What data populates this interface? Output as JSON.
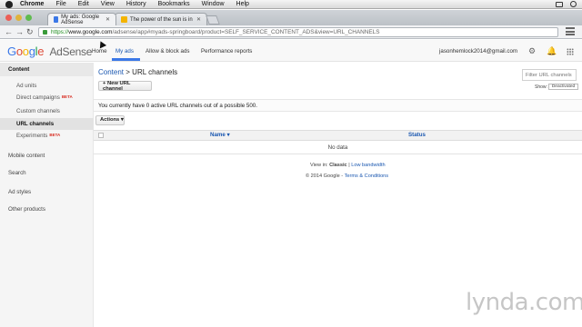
{
  "menubar": {
    "items": [
      "Chrome",
      "File",
      "Edit",
      "View",
      "History",
      "Bookmarks",
      "Window",
      "Help"
    ]
  },
  "browser": {
    "tabs": [
      {
        "title": "My ads: Google AdSense",
        "active": true
      },
      {
        "title": "The power of the sun is in",
        "active": false
      }
    ],
    "url": {
      "scheme": "https://",
      "host": "www.google.com",
      "path": "/adsense/app#myads-springboard/product=SELF_SERVICE_CONTENT_ADS&view=URL_CHANNELS"
    }
  },
  "header": {
    "logo_letters": [
      "G",
      "o",
      "o",
      "g",
      "l",
      "e"
    ],
    "product": "AdSense",
    "nav": [
      "Home",
      "My ads",
      "Allow & block ads",
      "Performance reports"
    ],
    "active_nav": "My ads",
    "email": "jasonhemlock2014@gmail.com",
    "icons": [
      "settings-gear-icon",
      "notifications-bell-icon",
      "help-icon",
      "apps-grid-icon"
    ]
  },
  "sidebar": {
    "content_header": "Content",
    "content_items": [
      {
        "label": "Ad units",
        "beta": ""
      },
      {
        "label": "Direct campaigns",
        "beta": "BETA"
      },
      {
        "label": "Custom channels",
        "beta": ""
      },
      {
        "label": "URL channels",
        "beta": ""
      },
      {
        "label": "Experiments",
        "beta": "BETA"
      }
    ],
    "selected": "URL channels",
    "sections": [
      "Mobile content",
      "Search",
      "Ad styles",
      "Other products"
    ]
  },
  "main": {
    "breadcrumb": {
      "parent": "Content",
      "separator": ">",
      "current": "URL channels"
    },
    "filter_placeholder": "Filter URL channels",
    "new_button": "+ New URL channel",
    "show_label": "Show:",
    "show_value": "Deactivated",
    "notice": "You currently have 0 active URL channels out of a possible 500.",
    "actions_button": "Actions ▾",
    "table": {
      "columns": [
        "Name ▾",
        "Status"
      ],
      "empty": "No data"
    }
  },
  "footer": {
    "view_in_label": "View in:",
    "view_current": "Classic",
    "separator": "|",
    "view_alt": "Low bandwidth",
    "copyright": "© 2014 Google -",
    "terms": "Terms & Conditions"
  },
  "watermark": "lynda.com",
  "colors": {
    "accent": "#3b78e7",
    "link": "#1a57b0",
    "beta": "#d93025"
  }
}
